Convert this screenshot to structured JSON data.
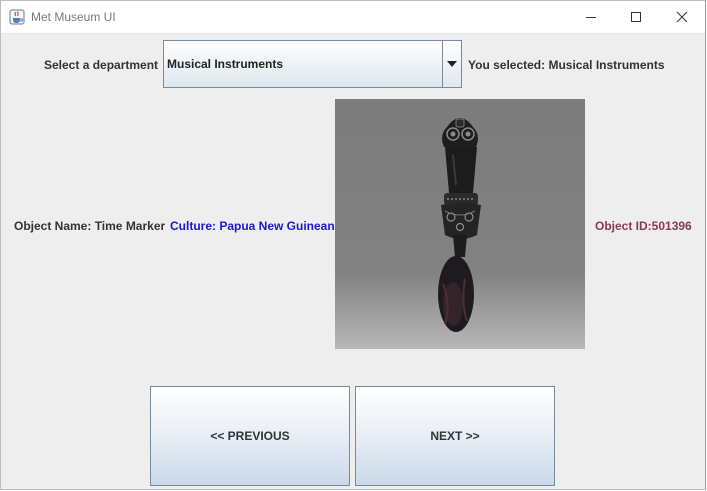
{
  "window": {
    "title": "Met Museum UI"
  },
  "department": {
    "label": "Select a department",
    "selected": "Musical Instruments",
    "selected_text": "You selected: Musical Instruments"
  },
  "object": {
    "name_text": "Object Name: Time Marker",
    "culture_text": "Culture: Papua New Guinean",
    "id_text": "Object ID:501396"
  },
  "buttons": {
    "previous": "<< PREVIOUS",
    "next": "NEXT >>"
  },
  "colors": {
    "culture": "#1a1acc",
    "object_id": "#8e3a4b",
    "background": "#eeeeee"
  },
  "icons": [
    "java-cup-icon",
    "minimize-icon",
    "maximize-icon",
    "close-icon",
    "dropdown-arrow-icon"
  ]
}
